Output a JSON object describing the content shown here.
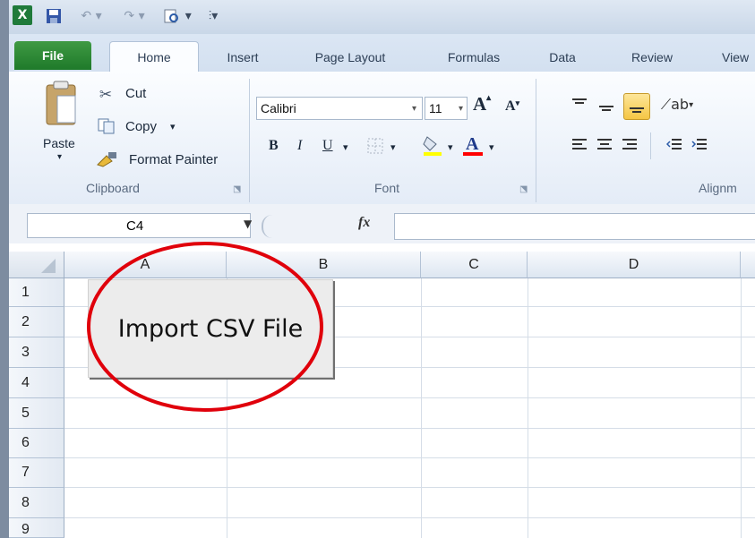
{
  "ribbon": {
    "tabs": [
      "File",
      "Home",
      "Insert",
      "Page Layout",
      "Formulas",
      "Data",
      "Review",
      "View"
    ],
    "clipboard": {
      "paste_label": "Paste",
      "cut_label": "Cut",
      "copy_label": "Copy",
      "format_painter_label": "Format Painter",
      "group_label": "Clipboard"
    },
    "font": {
      "font_name": "Calibri",
      "font_size": "11",
      "group_label": "Font"
    },
    "alignment": {
      "group_label": "Alignm"
    }
  },
  "formula_bar": {
    "name_box": "C4",
    "fx_label": "fx"
  },
  "sheet": {
    "columns": [
      "A",
      "B",
      "C",
      "D"
    ],
    "rows": [
      "1",
      "2",
      "3",
      "4",
      "5",
      "6",
      "7",
      "8",
      "9"
    ],
    "button_label": "Import CSV File"
  },
  "colors": {
    "file_tab": "#2a8a35",
    "annotation": "#e0000b",
    "ribbon_bg": "#e4ecf7"
  }
}
